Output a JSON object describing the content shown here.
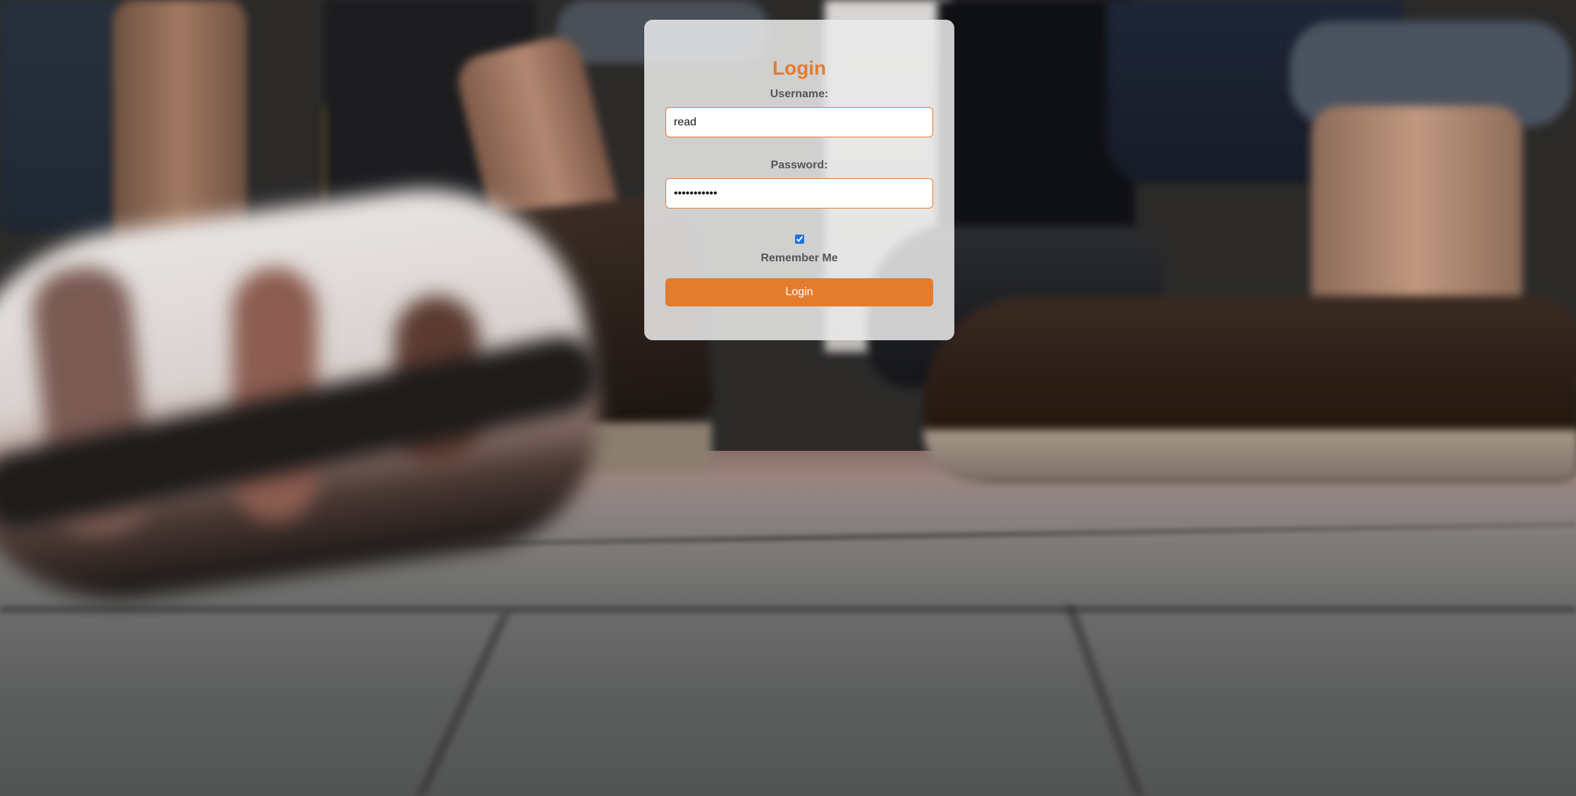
{
  "login": {
    "title": "Login",
    "username_label": "Username:",
    "username_value": "read",
    "password_label": "Password:",
    "password_value": "•••••••••••",
    "remember_label": "Remember Me",
    "remember_checked": true,
    "button_label": "Login"
  },
  "colors": {
    "accent": "#e47c2e",
    "label_text": "#555555",
    "card_background": "rgba(235,235,235,0.86)"
  },
  "background": {
    "description_icon": "photo-background"
  }
}
